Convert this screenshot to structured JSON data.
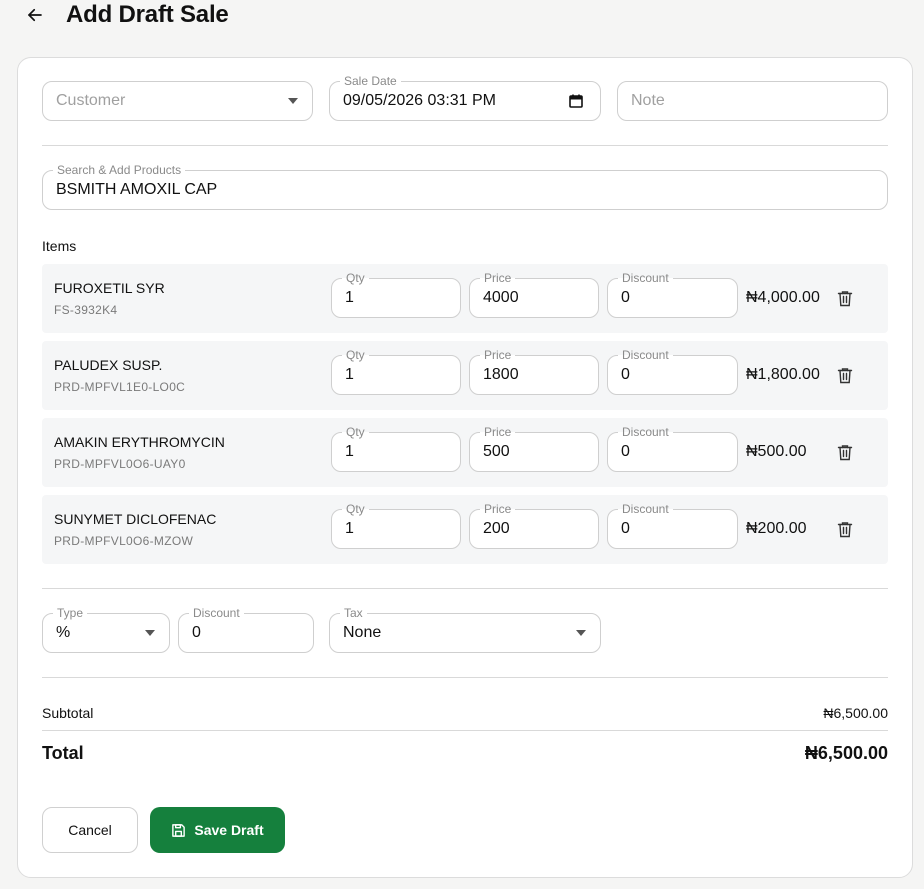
{
  "header": {
    "title": "Add Draft Sale"
  },
  "form": {
    "customer": {
      "placeholder": "Customer"
    },
    "sale_date": {
      "label": "Sale Date",
      "value": "09/05/2026 03:31 PM"
    },
    "note": {
      "placeholder": "Note"
    },
    "search": {
      "label": "Search & Add Products",
      "value": "BSMITH AMOXIL CAP"
    }
  },
  "items_label": "Items",
  "item_field_labels": {
    "qty": "Qty",
    "price": "Price",
    "discount": "Discount"
  },
  "items": [
    {
      "name": "FUROXETIL SYR",
      "sku": "FS-3932K4",
      "qty": "1",
      "price": "4000",
      "discount": "0",
      "total": "₦4,000.00"
    },
    {
      "name": "PALUDEX SUSP.",
      "sku": "PRD-MPFVL1E0-LO0C",
      "qty": "1",
      "price": "1800",
      "discount": "0",
      "total": "₦1,800.00"
    },
    {
      "name": "AMAKIN ERYTHROMYCIN",
      "sku": "PRD-MPFVL0O6-UAY0",
      "qty": "1",
      "price": "500",
      "discount": "0",
      "total": "₦500.00"
    },
    {
      "name": "SUNYMET DICLOFENAC",
      "sku": "PRD-MPFVL0O6-MZOW",
      "qty": "1",
      "price": "200",
      "discount": "0",
      "total": "₦200.00"
    }
  ],
  "adjustments": {
    "type": {
      "label": "Type",
      "value": "%"
    },
    "discount": {
      "label": "Discount",
      "value": "0"
    },
    "tax": {
      "label": "Tax",
      "value": "None"
    }
  },
  "summary": {
    "subtotal_label": "Subtotal",
    "subtotal_value": "₦6,500.00",
    "total_label": "Total",
    "total_value": "₦6,500.00"
  },
  "actions": {
    "cancel_label": "Cancel",
    "save_label": "Save Draft"
  },
  "colors": {
    "primary": "#15803d",
    "row_bg": "#f5f6f7",
    "border": "#cfcfcf"
  },
  "icons": {
    "back": "arrow-left-icon",
    "calendar": "calendar-icon",
    "trash": "trash-icon",
    "save": "floppy-disk-icon"
  }
}
